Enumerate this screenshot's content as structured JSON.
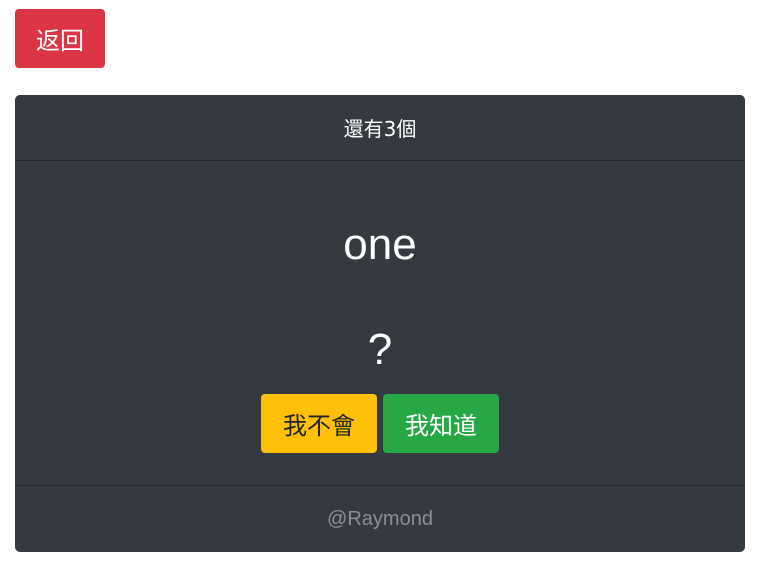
{
  "back_button": {
    "label": "返回"
  },
  "card": {
    "header": "還有3個",
    "word": "one",
    "answer": "?",
    "buttons": {
      "dont_know": "我不會",
      "know": "我知道"
    },
    "footer": "@Raymond"
  },
  "colors": {
    "back_button": "#dc3545",
    "card_bg": "#343a40",
    "dont_know_button": "#ffc107",
    "know_button": "#28a745",
    "footer_text": "#8a8f94"
  }
}
